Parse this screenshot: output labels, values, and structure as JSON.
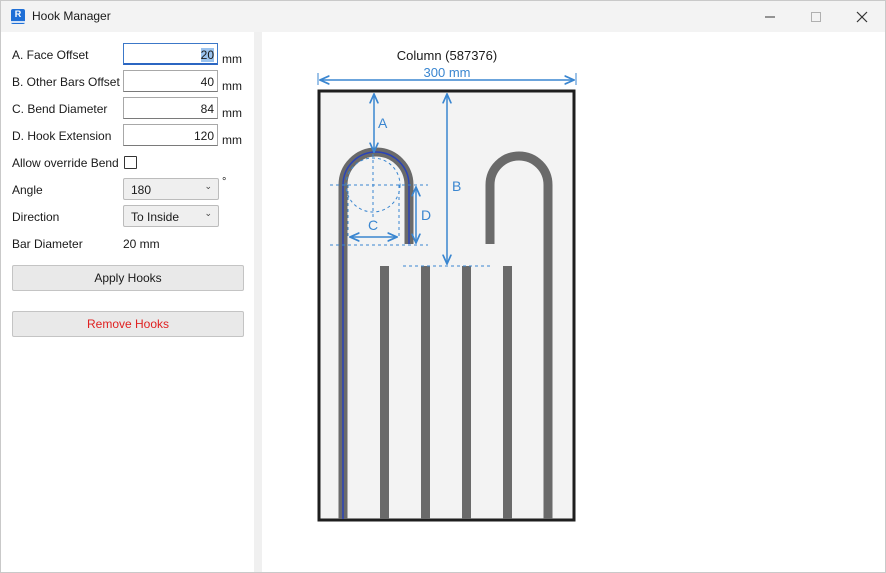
{
  "window": {
    "title": "Hook Manager",
    "icon_label": "R"
  },
  "controls": {
    "minimize_icon": "minimize-icon",
    "maximize_icon": "maximize-icon",
    "close_icon": "close-icon"
  },
  "form": {
    "face_offset": {
      "label": "A. Face Offset",
      "value": "20",
      "unit": "mm"
    },
    "other_bars_offset": {
      "label": "B. Other Bars Offset",
      "value": "40",
      "unit": "mm"
    },
    "bend_diameter": {
      "label": "C. Bend Diameter",
      "value": "84",
      "unit": "mm"
    },
    "hook_extension": {
      "label": "D. Hook Extension",
      "value": "120",
      "unit": "mm"
    },
    "allow_override": {
      "label": "Allow override Bend",
      "checked": false
    },
    "angle": {
      "label": "Angle",
      "value": "180",
      "unit": "°"
    },
    "direction": {
      "label": "Direction",
      "value": "To Inside"
    },
    "bar_diameter": {
      "label": "Bar Diameter",
      "value": "20 mm"
    }
  },
  "buttons": {
    "apply": "Apply Hooks",
    "remove": "Remove Hooks"
  },
  "diagram": {
    "column_title": "Column (587376)",
    "width_label": "300 mm",
    "dim_a": "A",
    "dim_b": "B",
    "dim_c": "C",
    "dim_d": "D",
    "colors": {
      "dimension": "#3a86d0",
      "bar": "#6a6a6a",
      "highlight": "#2a43b8",
      "outline": "#1e1e1e",
      "fill": "#f3f3f3"
    }
  }
}
